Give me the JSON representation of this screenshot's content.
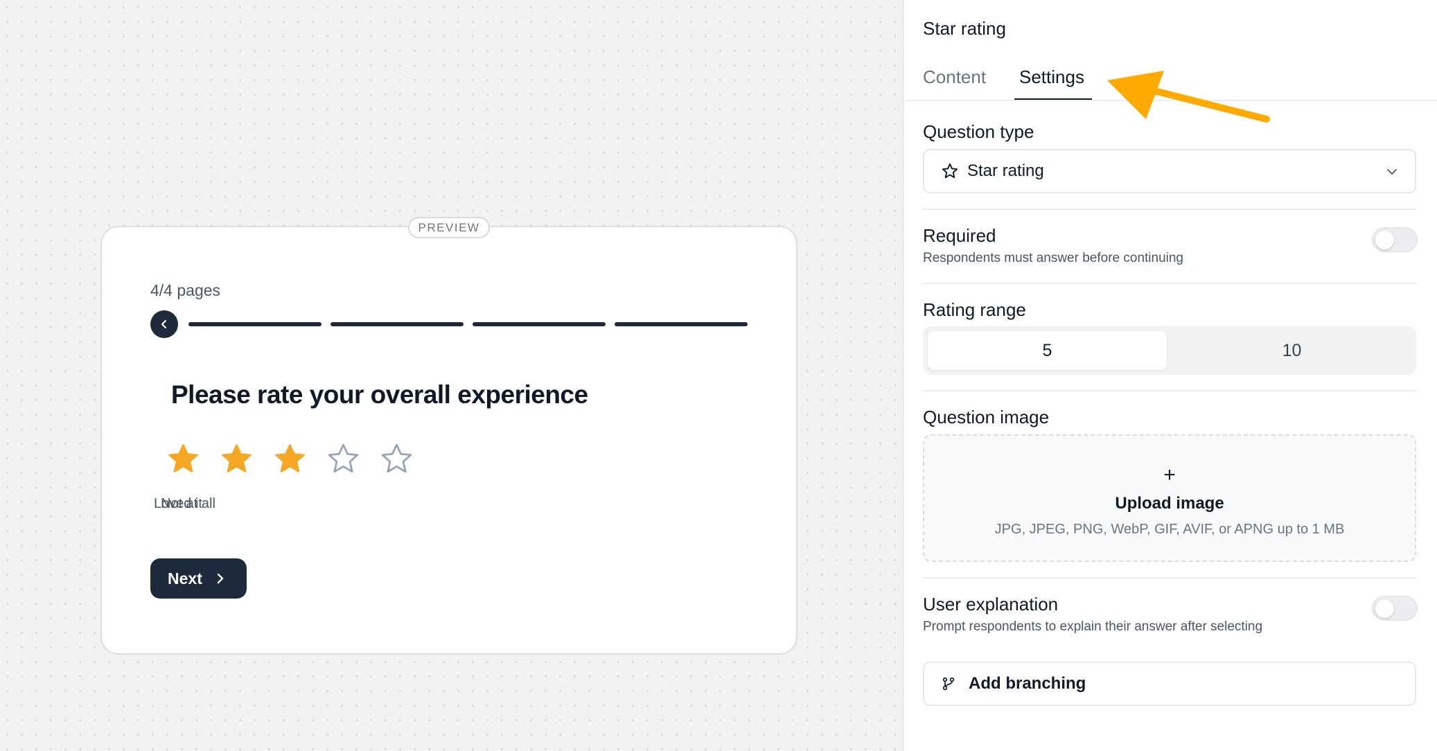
{
  "preview": {
    "badge": "PREVIEW",
    "pages_label": "4/4 pages",
    "progress_segments": 4,
    "question_title": "Please rate your overall experience",
    "rating": {
      "value": 3,
      "max": 5
    },
    "scale_low_label": "Not at all",
    "scale_high_label": "Loved it",
    "next_label": "Next",
    "icons": {
      "back": "chevron-left-icon",
      "next": "chevron-right-icon",
      "star": "star-icon"
    }
  },
  "panel": {
    "title": "Star rating",
    "tabs": [
      {
        "label": "Content",
        "active": false
      },
      {
        "label": "Settings",
        "active": true
      }
    ],
    "question_type": {
      "label": "Question type",
      "value": "Star rating"
    },
    "required": {
      "label": "Required",
      "hint": "Respondents must answer before continuing",
      "enabled": false
    },
    "rating_range": {
      "label": "Rating range",
      "options": [
        "5",
        "10"
      ],
      "selected": "5"
    },
    "question_image": {
      "label": "Question image",
      "plus": "+",
      "upload_label": "Upload image",
      "upload_hint": "JPG, JPEG, PNG, WebP, GIF, AVIF, or APNG up to 1 MB"
    },
    "user_explanation": {
      "label": "User explanation",
      "hint": "Prompt respondents to explain their answer after selecting",
      "enabled": false
    },
    "add_branching_label": "Add branching"
  },
  "colors": {
    "star_filled": "#F5A623",
    "star_empty": "#94A3B8",
    "dark": "#1E293B",
    "arrow": "#FFAA00"
  }
}
